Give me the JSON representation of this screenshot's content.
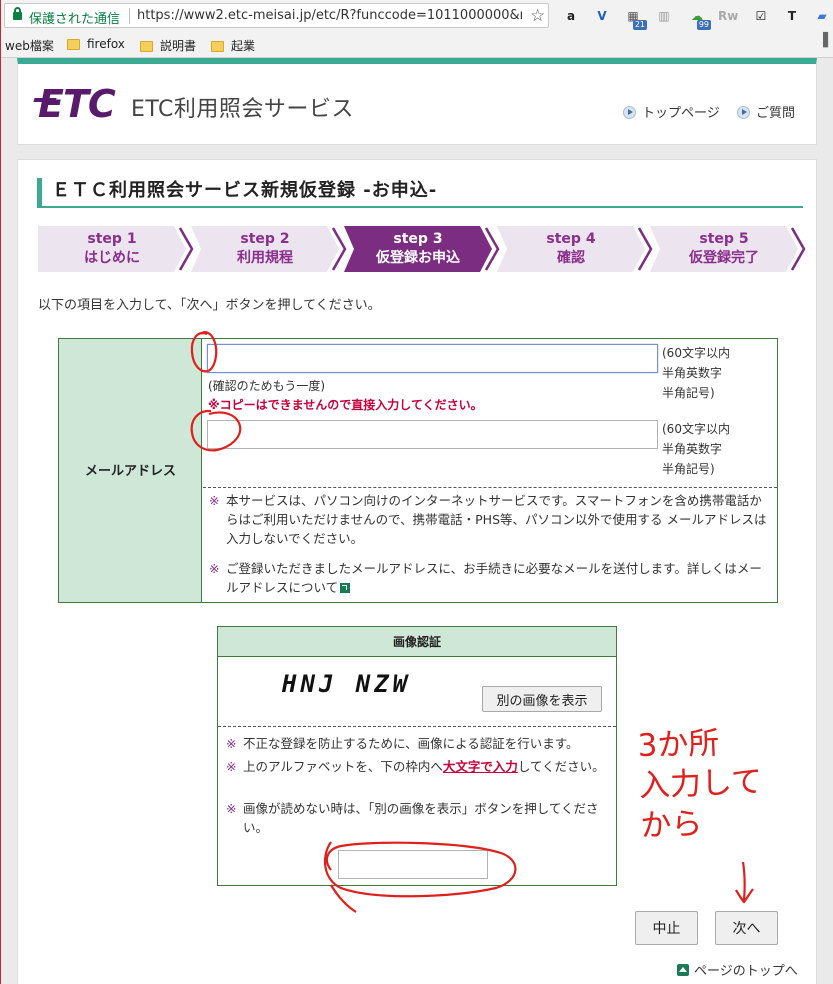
{
  "browser": {
    "secure_label": "保護された通信",
    "url": "https://www2.etc-meisai.jp/etc/R?funccode=1011000000&n...",
    "extensions": [
      {
        "icon": "amazon-icon",
        "glyph": "a",
        "color": "#222"
      },
      {
        "icon": "vivaldi-icon",
        "glyph": "V",
        "color": "#1a5fc8"
      },
      {
        "icon": "calendar-icon",
        "glyph": "▦",
        "color": "#555",
        "badge": "21"
      },
      {
        "icon": "reader-icon",
        "glyph": "▥",
        "color": "#999"
      },
      {
        "icon": "weather-icon",
        "glyph": "☁",
        "color": "#3a9a3a",
        "badge": "99"
      },
      {
        "icon": "rw-icon",
        "glyph": "Rw",
        "color": "#aaa"
      },
      {
        "icon": "check-icon",
        "glyph": "☑",
        "color": "#111"
      },
      {
        "icon": "text-icon",
        "glyph": "T",
        "color": "#222"
      },
      {
        "icon": "chat-icon",
        "glyph": "▰",
        "color": "#3b78d8"
      }
    ],
    "bookmarks": [
      "web檔案",
      "firefox",
      "説明書",
      "起業"
    ]
  },
  "header": {
    "logo": "ETC",
    "service_name": "ETC利用照会サービス",
    "links": [
      "トップページ",
      "ご質問"
    ]
  },
  "main": {
    "title": "ＥＴＣ利用照会サービス新規仮登録 -お申込-",
    "steps": [
      {
        "num": "step 1",
        "label": "はじめに",
        "active": false
      },
      {
        "num": "step 2",
        "label": "利用規程",
        "active": false
      },
      {
        "num": "step 3",
        "label": "仮登録お申込",
        "active": true
      },
      {
        "num": "step 4",
        "label": "確認",
        "active": false
      },
      {
        "num": "step 5",
        "label": "仮登録完了",
        "active": false
      }
    ],
    "instruction": "以下の項目を入力して、「次へ」ボタンを押してください。",
    "email": {
      "label": "メールアドレス",
      "hint_lines": [
        "(60文字以内",
        "半角英数字",
        "半角記号)"
      ],
      "confirm_label": "(確認のためもう一度)",
      "no_copy_warning": "※コピーはできませんので直接入力してください。",
      "notes": [
        "本サービスは、パソコン向けのインターネットサービスです。スマートフォンを含め携帯電話からはご利用いただけませんので、携帯電話・PHS等、パソコン以外で使用する メールアドレスは入力しないでください。",
        "ご登録いただきましたメールアドレスに、お手続きに必要なメールを送付します。詳しくはメールアドレスについて"
      ]
    },
    "captcha": {
      "heading": "画像認証",
      "image_text": "HNJ NZW",
      "new_image_label": "別の画像を表示",
      "notes": [
        {
          "before": "不正な登録を防止するために、画像による認証を行います。",
          "highlight": "",
          "after": ""
        },
        {
          "before": "上のアルファベットを、下の枠内へ",
          "highlight": "大文字で入力",
          "after": "してください。"
        },
        {
          "before": "画像が読めない時は、「別の画像を表示」ボタンを押してください。",
          "highlight": "",
          "after": ""
        }
      ]
    },
    "buttons": {
      "cancel": "中止",
      "next": "次へ"
    },
    "page_top": "ページのトップへ"
  },
  "annotation": {
    "text_lines": [
      "3か所",
      "入力して",
      "から"
    ],
    "color": "#e0201c"
  },
  "kome": "※"
}
